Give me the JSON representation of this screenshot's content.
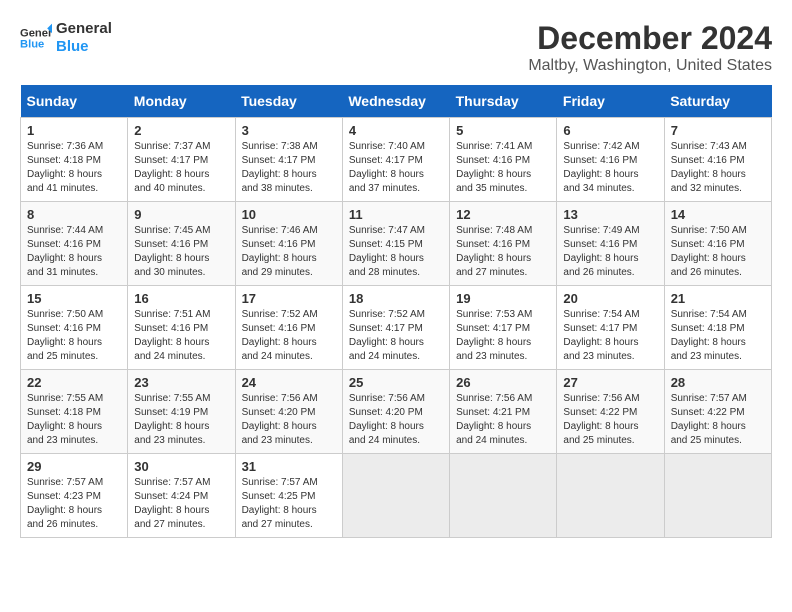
{
  "header": {
    "logo_line1": "General",
    "logo_line2": "Blue",
    "title": "December 2024",
    "subtitle": "Maltby, Washington, United States"
  },
  "weekdays": [
    "Sunday",
    "Monday",
    "Tuesday",
    "Wednesday",
    "Thursday",
    "Friday",
    "Saturday"
  ],
  "weeks": [
    [
      {
        "day": "1",
        "sunrise": "Sunrise: 7:36 AM",
        "sunset": "Sunset: 4:18 PM",
        "daylight": "Daylight: 8 hours and 41 minutes."
      },
      {
        "day": "2",
        "sunrise": "Sunrise: 7:37 AM",
        "sunset": "Sunset: 4:17 PM",
        "daylight": "Daylight: 8 hours and 40 minutes."
      },
      {
        "day": "3",
        "sunrise": "Sunrise: 7:38 AM",
        "sunset": "Sunset: 4:17 PM",
        "daylight": "Daylight: 8 hours and 38 minutes."
      },
      {
        "day": "4",
        "sunrise": "Sunrise: 7:40 AM",
        "sunset": "Sunset: 4:17 PM",
        "daylight": "Daylight: 8 hours and 37 minutes."
      },
      {
        "day": "5",
        "sunrise": "Sunrise: 7:41 AM",
        "sunset": "Sunset: 4:16 PM",
        "daylight": "Daylight: 8 hours and 35 minutes."
      },
      {
        "day": "6",
        "sunrise": "Sunrise: 7:42 AM",
        "sunset": "Sunset: 4:16 PM",
        "daylight": "Daylight: 8 hours and 34 minutes."
      },
      {
        "day": "7",
        "sunrise": "Sunrise: 7:43 AM",
        "sunset": "Sunset: 4:16 PM",
        "daylight": "Daylight: 8 hours and 32 minutes."
      }
    ],
    [
      {
        "day": "8",
        "sunrise": "Sunrise: 7:44 AM",
        "sunset": "Sunset: 4:16 PM",
        "daylight": "Daylight: 8 hours and 31 minutes."
      },
      {
        "day": "9",
        "sunrise": "Sunrise: 7:45 AM",
        "sunset": "Sunset: 4:16 PM",
        "daylight": "Daylight: 8 hours and 30 minutes."
      },
      {
        "day": "10",
        "sunrise": "Sunrise: 7:46 AM",
        "sunset": "Sunset: 4:16 PM",
        "daylight": "Daylight: 8 hours and 29 minutes."
      },
      {
        "day": "11",
        "sunrise": "Sunrise: 7:47 AM",
        "sunset": "Sunset: 4:15 PM",
        "daylight": "Daylight: 8 hours and 28 minutes."
      },
      {
        "day": "12",
        "sunrise": "Sunrise: 7:48 AM",
        "sunset": "Sunset: 4:16 PM",
        "daylight": "Daylight: 8 hours and 27 minutes."
      },
      {
        "day": "13",
        "sunrise": "Sunrise: 7:49 AM",
        "sunset": "Sunset: 4:16 PM",
        "daylight": "Daylight: 8 hours and 26 minutes."
      },
      {
        "day": "14",
        "sunrise": "Sunrise: 7:50 AM",
        "sunset": "Sunset: 4:16 PM",
        "daylight": "Daylight: 8 hours and 26 minutes."
      }
    ],
    [
      {
        "day": "15",
        "sunrise": "Sunrise: 7:50 AM",
        "sunset": "Sunset: 4:16 PM",
        "daylight": "Daylight: 8 hours and 25 minutes."
      },
      {
        "day": "16",
        "sunrise": "Sunrise: 7:51 AM",
        "sunset": "Sunset: 4:16 PM",
        "daylight": "Daylight: 8 hours and 24 minutes."
      },
      {
        "day": "17",
        "sunrise": "Sunrise: 7:52 AM",
        "sunset": "Sunset: 4:16 PM",
        "daylight": "Daylight: 8 hours and 24 minutes."
      },
      {
        "day": "18",
        "sunrise": "Sunrise: 7:52 AM",
        "sunset": "Sunset: 4:17 PM",
        "daylight": "Daylight: 8 hours and 24 minutes."
      },
      {
        "day": "19",
        "sunrise": "Sunrise: 7:53 AM",
        "sunset": "Sunset: 4:17 PM",
        "daylight": "Daylight: 8 hours and 23 minutes."
      },
      {
        "day": "20",
        "sunrise": "Sunrise: 7:54 AM",
        "sunset": "Sunset: 4:17 PM",
        "daylight": "Daylight: 8 hours and 23 minutes."
      },
      {
        "day": "21",
        "sunrise": "Sunrise: 7:54 AM",
        "sunset": "Sunset: 4:18 PM",
        "daylight": "Daylight: 8 hours and 23 minutes."
      }
    ],
    [
      {
        "day": "22",
        "sunrise": "Sunrise: 7:55 AM",
        "sunset": "Sunset: 4:18 PM",
        "daylight": "Daylight: 8 hours and 23 minutes."
      },
      {
        "day": "23",
        "sunrise": "Sunrise: 7:55 AM",
        "sunset": "Sunset: 4:19 PM",
        "daylight": "Daylight: 8 hours and 23 minutes."
      },
      {
        "day": "24",
        "sunrise": "Sunrise: 7:56 AM",
        "sunset": "Sunset: 4:20 PM",
        "daylight": "Daylight: 8 hours and 23 minutes."
      },
      {
        "day": "25",
        "sunrise": "Sunrise: 7:56 AM",
        "sunset": "Sunset: 4:20 PM",
        "daylight": "Daylight: 8 hours and 24 minutes."
      },
      {
        "day": "26",
        "sunrise": "Sunrise: 7:56 AM",
        "sunset": "Sunset: 4:21 PM",
        "daylight": "Daylight: 8 hours and 24 minutes."
      },
      {
        "day": "27",
        "sunrise": "Sunrise: 7:56 AM",
        "sunset": "Sunset: 4:22 PM",
        "daylight": "Daylight: 8 hours and 25 minutes."
      },
      {
        "day": "28",
        "sunrise": "Sunrise: 7:57 AM",
        "sunset": "Sunset: 4:22 PM",
        "daylight": "Daylight: 8 hours and 25 minutes."
      }
    ],
    [
      {
        "day": "29",
        "sunrise": "Sunrise: 7:57 AM",
        "sunset": "Sunset: 4:23 PM",
        "daylight": "Daylight: 8 hours and 26 minutes."
      },
      {
        "day": "30",
        "sunrise": "Sunrise: 7:57 AM",
        "sunset": "Sunset: 4:24 PM",
        "daylight": "Daylight: 8 hours and 27 minutes."
      },
      {
        "day": "31",
        "sunrise": "Sunrise: 7:57 AM",
        "sunset": "Sunset: 4:25 PM",
        "daylight": "Daylight: 8 hours and 27 minutes."
      },
      null,
      null,
      null,
      null
    ]
  ]
}
